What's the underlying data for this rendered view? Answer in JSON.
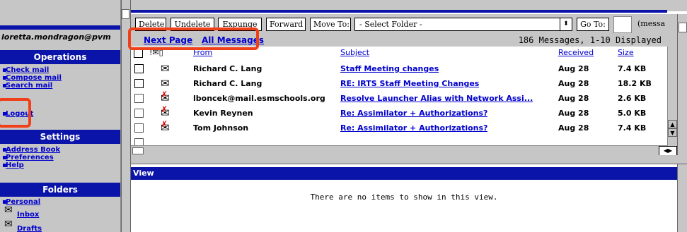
{
  "sidebar": {
    "user": "loretta.mondragon@pvm",
    "operations": {
      "title": "Operations",
      "items": [
        "Check mail",
        "Compose mail",
        "Search mail"
      ]
    },
    "logout": "Logout",
    "settings": {
      "title": "Settings",
      "items": [
        "Address Book",
        "Preferences",
        "Help"
      ]
    },
    "folders": {
      "title": "Folders",
      "personal": "Personal",
      "items": [
        "Inbox",
        "Drafts"
      ]
    }
  },
  "toolbar": {
    "delete": "Delete",
    "undelete": "Undelete",
    "expunge": "Expunge",
    "forward": "Forward",
    "move_to": "Move To:",
    "folder_select": "- Select Folder -",
    "go_to": "Go To:",
    "tail": "(messa"
  },
  "nav": {
    "next_page": "Next Page",
    "all_messages": "All Messages",
    "count": "186 Messages, 1-10 Displayed"
  },
  "list": {
    "headers": {
      "from": "From",
      "subject": "Subject",
      "received": "Received",
      "size": "Size"
    },
    "rows": [
      {
        "from": "Richard C. Lang",
        "subject": "Staff Meeting changes",
        "received": "Aug 28",
        "size": "7.4 KB",
        "status": "read"
      },
      {
        "from": "Richard C. Lang",
        "subject": "RE: IRTS Staff Meeting Changes",
        "received": "Aug 28",
        "size": "18.2 KB",
        "status": "read"
      },
      {
        "from": "lboncek@mail.esmschools.org",
        "subject": "Resolve Launcher Alias with Network Assi...",
        "received": "Aug 28",
        "size": "2.6 KB",
        "status": "deleted"
      },
      {
        "from": "Kevin Reynen",
        "subject": "Re: Assimilator + Authorizations?",
        "received": "Aug 28",
        "size": "5.0 KB",
        "status": "deleted"
      },
      {
        "from": "Tom Johnson",
        "subject": "Re: Assimilator + Authorizations?",
        "received": "Aug 28",
        "size": "7.4 KB",
        "status": "deleted"
      }
    ]
  },
  "view": {
    "title": "View",
    "empty": "There are no items to show in this view."
  },
  "colors": {
    "accent": "#0a14a8",
    "link": "#0000cc",
    "chrome": "#c6c6c6",
    "highlight": "#f0401a"
  },
  "icons": [
    "envelope-icon",
    "deleted-envelope-icon",
    "attachment-icon",
    "grip-icon"
  ]
}
